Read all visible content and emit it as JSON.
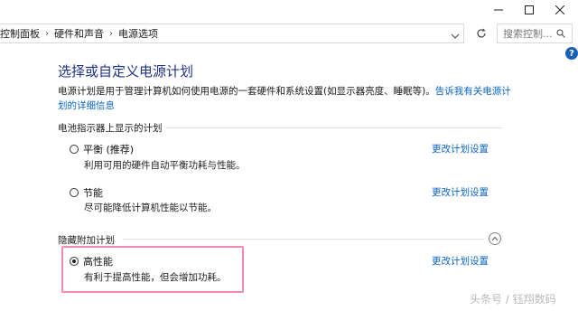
{
  "window": {
    "minimize_icon": "minimize-icon",
    "maximize_icon": "maximize-icon",
    "close_icon": "close-icon"
  },
  "address_bar": {
    "crumbs": [
      "控制面板",
      "硬件和声音",
      "电源选项"
    ]
  },
  "search": {
    "placeholder": "搜索控制..."
  },
  "help": {
    "label": "?"
  },
  "page": {
    "title": "选择或自定义电源计划",
    "description_text": "电源计划是用于管理计算机如何使用电源的一套硬件和系统设置(如显示器亮度、睡眠等)。",
    "description_link": "告诉我有关电源计划的详细信息"
  },
  "battery_section": {
    "label": "电池指示器上显示的计划",
    "plans": [
      {
        "name": "平衡 (推荐)",
        "desc": "利用可用的硬件自动平衡功耗与性能。",
        "link": "更改计划设置",
        "selected": false
      },
      {
        "name": "节能",
        "desc": "尽可能降低计算机性能以节能。",
        "link": "更改计划设置",
        "selected": false
      }
    ]
  },
  "hidden_section": {
    "label": "隐藏附加计划",
    "plans": [
      {
        "name": "高性能",
        "desc": "有利于提高性能，但会增加功耗。",
        "link": "更改计划设置",
        "selected": true
      }
    ]
  },
  "watermark": "头条号 / 钰翔数码",
  "colors": {
    "title": "#1e3287",
    "link": "#0a64c8",
    "highlight": "#f08cb4"
  }
}
